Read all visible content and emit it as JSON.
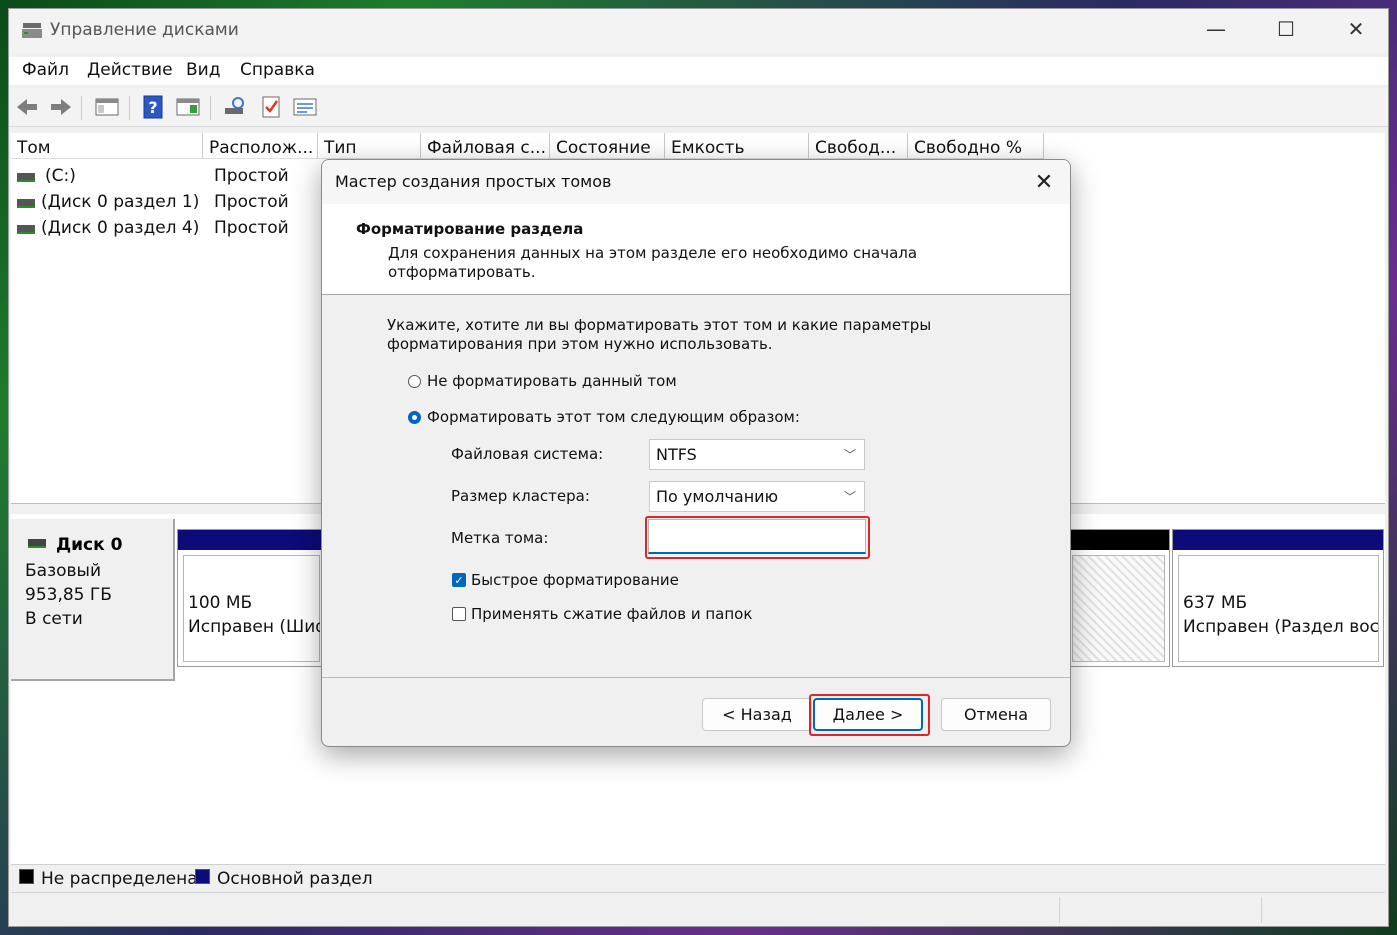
{
  "window": {
    "title": "Управление дисками",
    "controls": {
      "minimize": "—",
      "maximize": "☐",
      "close": "✕"
    }
  },
  "menu": [
    "Файл",
    "Действие",
    "Вид",
    "Справка"
  ],
  "toolbar": {
    "buttons": [
      "back-arrow-icon",
      "forward-arrow-icon",
      "console-tree-icon",
      "help-icon",
      "properties-panel-icon",
      "refresh-disk-icon",
      "check-icon",
      "settings-list-icon"
    ]
  },
  "volume_list": {
    "columns": [
      "Том",
      "Располож...",
      "Тип",
      "Файловая с...",
      "Состояние",
      "Емкость",
      "Свобод...",
      "Свободно %"
    ],
    "rows": [
      {
        "name": "(C:)",
        "layout": "Простой"
      },
      {
        "name": "(Диск 0 раздел 1)",
        "layout": "Простой"
      },
      {
        "name": "(Диск 0 раздел 4)",
        "layout": "Простой"
      }
    ]
  },
  "disk_map": {
    "disk_name": "Диск 0",
    "disk_type": "Базовый",
    "disk_size": "953,85 ГБ",
    "disk_status": "В сети",
    "partitions": [
      {
        "size": "100 МБ",
        "status": "Исправен (Шифр"
      },
      {
        "size": "637 МБ",
        "status": "Исправен (Раздел восс"
      }
    ]
  },
  "legend": [
    {
      "label": "Не распределена",
      "color": "#000000"
    },
    {
      "label": "Основной раздел",
      "color": "#0b0b7a"
    }
  ],
  "dialog": {
    "title": "Мастер создания простых томов",
    "close": "✕",
    "header_title": "Форматирование раздела",
    "header_subtitle": "Для сохранения данных на этом разделе его необходимо сначала отформатировать.",
    "intro": "Укажите, хотите ли вы форматировать этот том и какие параметры форматирования при этом нужно использовать.",
    "option_no_format": "Не форматировать данный том",
    "option_format": "Форматировать этот том следующим образом:",
    "filesystem_label": "Файловая система:",
    "filesystem_value": "NTFS",
    "cluster_label": "Размер кластера:",
    "cluster_value": "По умолчанию",
    "volume_label_label": "Метка тома:",
    "volume_label_value": "",
    "quick_format_label": "Быстрое форматирование",
    "quick_format_checked": true,
    "compression_label": "Применять сжатие файлов и папок",
    "compression_checked": false,
    "back_button": "< Назад",
    "next_button": "Далее >",
    "cancel_button": "Отмена"
  },
  "colors": {
    "accent": "#0067c0",
    "highlight": "#e0242c",
    "primary_partition": "#0b0b7a"
  }
}
